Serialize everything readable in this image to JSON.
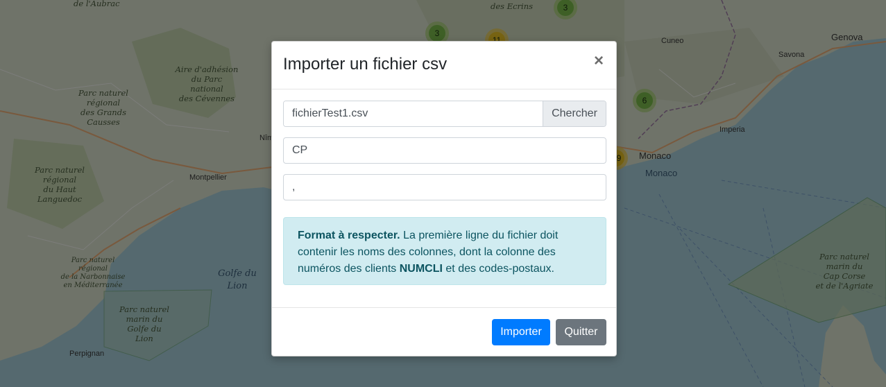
{
  "map": {
    "parks": [
      "Parc naturel régional des Grands Causses",
      "Aire d'adhésion du Parc national des Cévennes",
      "Parc naturel régional du Haut Languedoc",
      "Parc naturel régional de la Narbonnaise en Méditerranée",
      "Parc naturel marin du Golfe du Lion",
      "Parc naturel marin du Cap Corse et de l'Agriate"
    ],
    "cities": [
      "Montpellier",
      "Perpignan",
      "Cuneo",
      "Savona",
      "Genova",
      "Imperia",
      "Monaco",
      "Nîmes"
    ],
    "top_labels": [
      "de l'Aubrac",
      "des Ecrins"
    ],
    "sea": "Golfe du Lion",
    "markers": [
      "3",
      "3",
      "11",
      "6",
      "9"
    ]
  },
  "modal": {
    "title": "Importer un fichier csv",
    "close_symbol": "×",
    "file_name": "fichierTest1.csv",
    "browse_label": "Chercher",
    "column_value": "CP",
    "separator_value": ",",
    "alert": {
      "strong": "Format à respecter.",
      "text1": " La première ligne du fichier doit contenir les noms des colonnes, dont la colonne des numéros des clients ",
      "keyword": "NUMCLI",
      "text2": " et des codes-postaux."
    },
    "import_label": "Importer",
    "quit_label": "Quitter"
  },
  "colors": {
    "primary": "#007bff",
    "secondary": "#6c757d",
    "alert_bg": "#d1ecf1",
    "alert_text": "#0c5460",
    "overlay": "rgba(0,0,0,0.5)"
  }
}
